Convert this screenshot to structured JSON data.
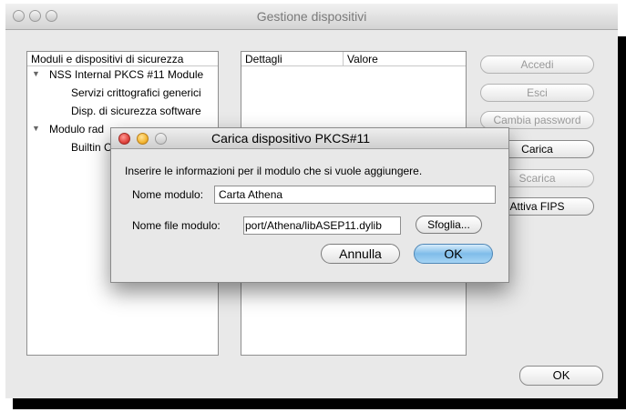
{
  "window": {
    "title": "Gestione dispositivi"
  },
  "modules_panel": {
    "header": "Moduli e dispositivi di sicurezza",
    "items": [
      {
        "label": "NSS Internal PKCS #11 Module",
        "level": 0,
        "expanded": true
      },
      {
        "label": "Servizi crittografici generici",
        "level": 1
      },
      {
        "label": "Disp. di sicurezza software",
        "level": 1
      },
      {
        "label": "Modulo rad",
        "level": 0,
        "expanded": true
      },
      {
        "label": "Builtin C",
        "level": 1
      }
    ]
  },
  "details_panel": {
    "col_details": "Dettagli",
    "col_value": "Valore"
  },
  "side_buttons": {
    "accedi": "Accedi",
    "esci": "Esci",
    "cambia_password": "Cambia password",
    "carica": "Carica",
    "scarica": "Scarica",
    "attiva_fips": "Attiva FIPS"
  },
  "ok_button": "OK",
  "dialog": {
    "title": "Carica dispositivo PKCS#11",
    "instruction": "Inserire le informazioni per il modulo che si vuole aggiungere.",
    "module_name_label": "Nome modulo:",
    "module_name_value": "Carta Athena",
    "module_file_label": "Nome file modulo:",
    "module_file_value": "port/Athena/libASEP11.dylib",
    "browse_label": "Sfoglia...",
    "cancel_label": "Annulla",
    "ok_label": "OK"
  },
  "colors": {
    "close_light": "#e0443e",
    "minimize_light": "#f3b632",
    "default_button": "#7fbde9"
  }
}
